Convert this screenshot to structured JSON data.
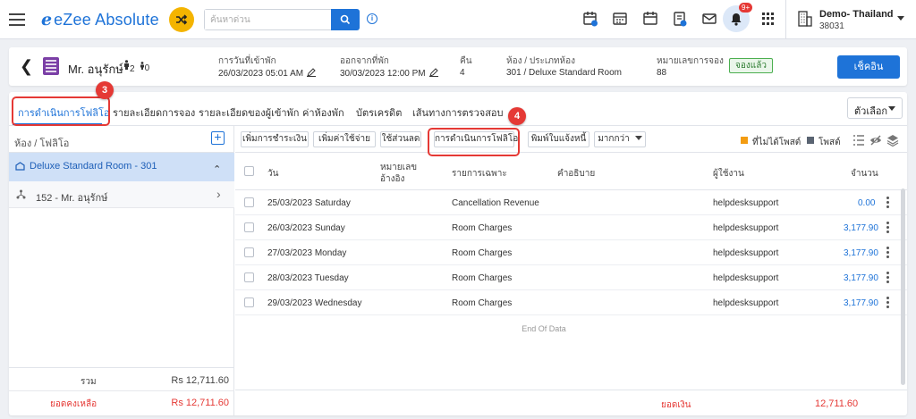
{
  "app": {
    "logo_mark": "e",
    "logo_text": "eZee Absolute",
    "search_placeholder": "ค้นหาด่วน",
    "notification_count": "9+",
    "property_name": "Demo- Thailand",
    "property_code": "38031"
  },
  "guest": {
    "name": "Mr. อนุรักษ์",
    "adults": "2",
    "children": "0",
    "arrival_label": "การวันที่เข้าพัก",
    "arrival_value": "26/03/2023 05:01 AM",
    "departure_label": "ออกจากที่พัก",
    "departure_value": "30/03/2023 12:00 PM",
    "nights_label": "คืน",
    "nights_value": "4",
    "room_label": "ห้อง / ประเภทห้อง",
    "room_value": "301 / Deluxe Standard Room",
    "reservation_label": "หมายเลขการจอง",
    "reservation_value": "88",
    "status": "จองแล้ว",
    "checkin_button": "เช็คอิน"
  },
  "tabs": [
    {
      "label": "การดำเนินการโฟลิโอ"
    },
    {
      "label": "รายละเอียดการจอง"
    },
    {
      "label": "รายละเอียดของผู้เข้าพัก"
    },
    {
      "label": "ค่าห้องพัก"
    },
    {
      "label": "บัตรเครดิต"
    },
    {
      "label": "เส้นทางการตรวจสอบ"
    }
  ],
  "options_label": "ตัวเลือก",
  "annotations": {
    "a3": "3",
    "a4": "4"
  },
  "left_pane": {
    "title": "ห้อง / โฟลิโอ",
    "room_item": "Deluxe Standard Room - 301",
    "guest_item": "152 - Mr. อนุรักษ์",
    "total_label": "รวม",
    "total_value": "Rs 12,711.60",
    "balance_label": "ยอดคงเหลือ",
    "balance_value": "Rs 12,711.60"
  },
  "toolbar": {
    "add_payment": "เพิ่มการชำระเงิน",
    "add_charge": "เพิ่มค่าใช้จ่าย",
    "apply_discount": "ใช้ส่วนลด",
    "folio_ops": "การดำเนินการโฟลิโอ",
    "print_invoice": "พิมพ์ใบแจ้งหนี้",
    "more": "มากกว่า",
    "legend_unposted": "ที่ไม่ได้โพสต์",
    "legend_posted": "โพสต์"
  },
  "colors": {
    "legend_unposted": "#f39c12",
    "legend_posted": "#5a6472",
    "accent": "#1e73d8",
    "annotation": "#e53935"
  },
  "table": {
    "headers": {
      "day": "วัน",
      "ref_line1": "หมายเลข",
      "ref_line2": "อ้างอิง",
      "particulars": "รายการเฉพาะ",
      "description": "คำอธิบาย",
      "user": "ผู้ใช้งาน",
      "amount": "จำนวน"
    },
    "rows": [
      {
        "day": "25/03/2023 Saturday",
        "particular": "Cancellation Revenue",
        "user": "helpdesksupport",
        "amount": "0.00"
      },
      {
        "day": "26/03/2023 Sunday",
        "particular": "Room Charges",
        "user": "helpdesksupport",
        "amount": "3,177.90"
      },
      {
        "day": "27/03/2023 Monday",
        "particular": "Room Charges",
        "user": "helpdesksupport",
        "amount": "3,177.90"
      },
      {
        "day": "28/03/2023 Tuesday",
        "particular": "Room Charges",
        "user": "helpdesksupport",
        "amount": "3,177.90"
      },
      {
        "day": "29/03/2023 Wednesday",
        "particular": "Room Charges",
        "user": "helpdesksupport",
        "amount": "3,177.90"
      }
    ],
    "end_of_data": "End Of Data",
    "footer_label": "ยอดเงิน",
    "footer_value": "12,711.60"
  }
}
